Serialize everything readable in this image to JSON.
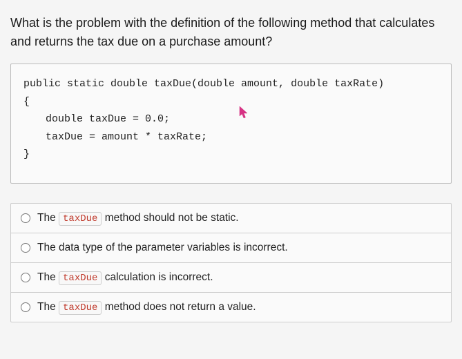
{
  "question": "What is the problem with the definition of the following method that calculates and returns the tax due on a purchase amount?",
  "code": {
    "line1": "public static double taxDue(double amount, double taxRate)",
    "line2": "{",
    "line3": "double taxDue = 0.0;",
    "line4": "taxDue = amount * taxRate;",
    "line5": "}"
  },
  "options": [
    {
      "prefix": "The ",
      "code": "taxDue",
      "suffix": " method should not be static."
    },
    {
      "prefix": "The data type of the parameter variables is incorrect.",
      "code": "",
      "suffix": ""
    },
    {
      "prefix": "The ",
      "code": "taxDue",
      "suffix": " calculation is incorrect."
    },
    {
      "prefix": "The ",
      "code": "taxDue",
      "suffix": " method does not return a value."
    }
  ]
}
